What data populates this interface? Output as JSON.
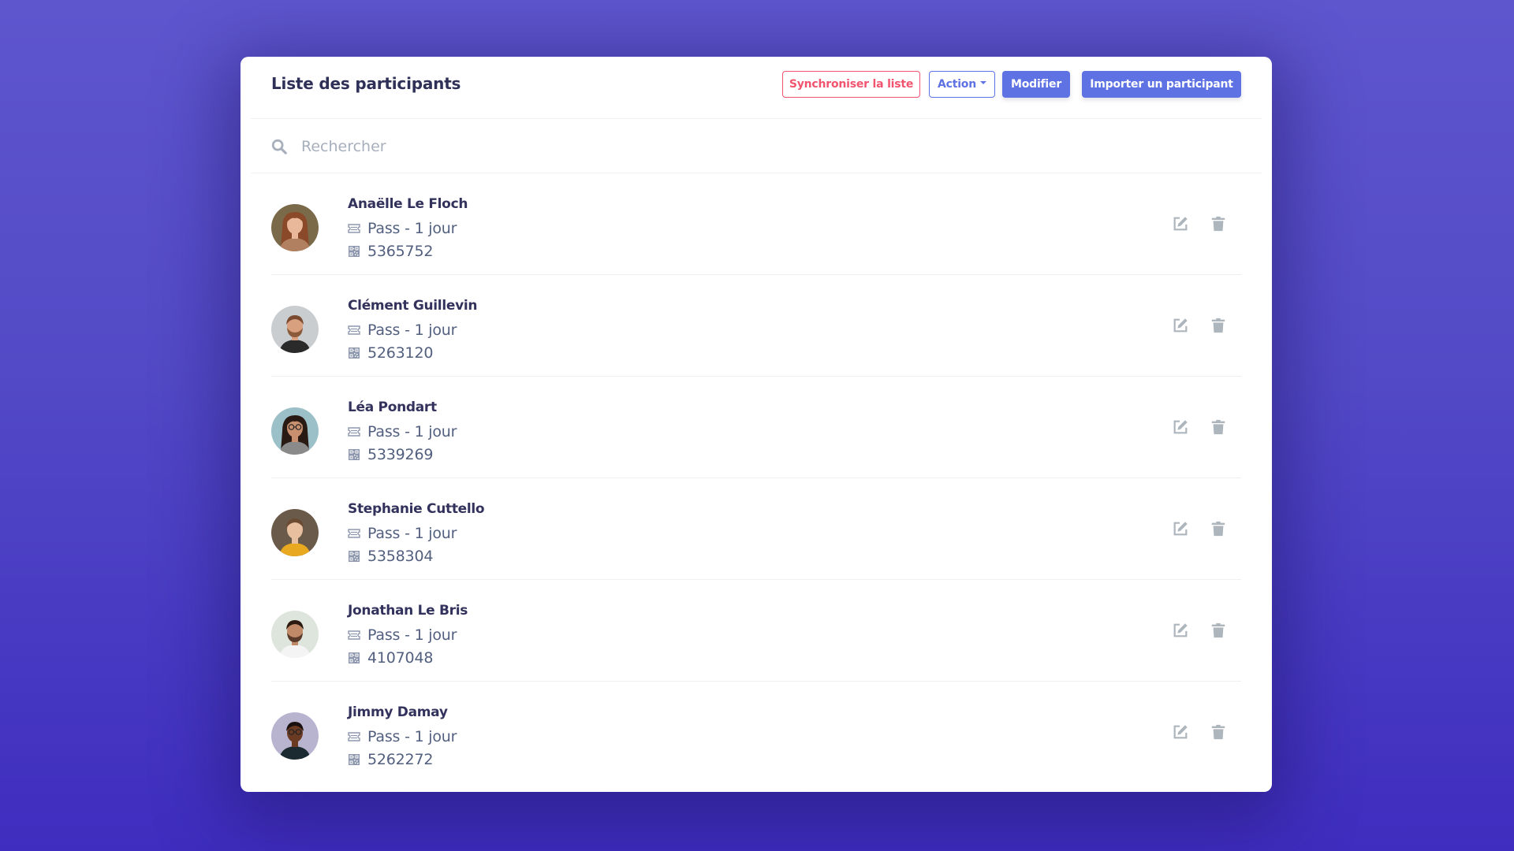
{
  "header": {
    "title": "Liste des participants",
    "buttons": {
      "sync": "Synchroniser la liste",
      "action": "Action",
      "modify": "Modifier",
      "import": "Importer un participant"
    }
  },
  "search": {
    "placeholder": "Rechercher",
    "value": ""
  },
  "colors": {
    "primary": "#5e72e4",
    "danger": "#f2536f",
    "text_dark": "#32325d",
    "text_muted": "#525f7f",
    "icon_gray": "#adb5bd"
  },
  "participants": [
    {
      "name": "Anaëlle Le Floch",
      "pass": "Pass - 1 jour",
      "ticket": "5365752",
      "avatar": "avatar-photo-woman-brown-hair"
    },
    {
      "name": "Clément Guillevin",
      "pass": "Pass - 1 jour",
      "ticket": "5263120",
      "avatar": "avatar-photo-bearded-man"
    },
    {
      "name": "Léa Pondart",
      "pass": "Pass - 1 jour",
      "ticket": "5339269",
      "avatar": "avatar-photo-woman-glasses"
    },
    {
      "name": "Stephanie Cuttello",
      "pass": "Pass - 1 jour",
      "ticket": "5358304",
      "avatar": "avatar-photo-woman-yellow-shirt"
    },
    {
      "name": "Jonathan Le Bris",
      "pass": "Pass - 1 jour",
      "ticket": "4107048",
      "avatar": "avatar-photo-man-white-shirt"
    },
    {
      "name": "Jimmy Damay",
      "pass": "Pass - 1 jour",
      "ticket": "5262272",
      "avatar": "avatar-photo-man-glasses"
    }
  ]
}
